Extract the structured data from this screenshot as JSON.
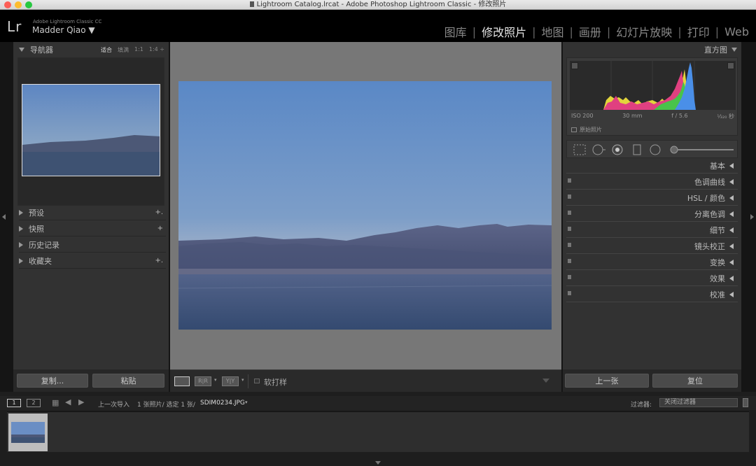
{
  "window": {
    "title": "Lightroom Catalog.lrcat - Adobe Photoshop Lightroom Classic - 修改照片",
    "traffic_colors": [
      "#fc5f57",
      "#fdbc2e",
      "#28c840"
    ]
  },
  "identity": {
    "logo": "Lr",
    "app_name": "Adobe Lightroom Classic CC",
    "user": "Madder Qiao ▼"
  },
  "modules": [
    {
      "label": "图库",
      "active": false
    },
    {
      "label": "修改照片",
      "active": true
    },
    {
      "label": "地图",
      "active": false
    },
    {
      "label": "画册",
      "active": false
    },
    {
      "label": "幻灯片放映",
      "active": false
    },
    {
      "label": "打印",
      "active": false
    },
    {
      "label": "Web",
      "active": false
    }
  ],
  "left": {
    "navigator": {
      "title": "导航器",
      "options": [
        "适合",
        "填满",
        "1:1",
        "1:4 ÷"
      ]
    },
    "panels": [
      {
        "label": "预设",
        "action": "+."
      },
      {
        "label": "快照",
        "action": "+"
      },
      {
        "label": "历史记录",
        "action": ""
      },
      {
        "label": "收藏夹",
        "action": "+."
      }
    ],
    "buttons": {
      "copy": "复制...",
      "paste": "粘贴"
    }
  },
  "toolbar": {
    "compare_label": "R|R",
    "yy_label": "Y|Y",
    "soft_proof": "软打样"
  },
  "right": {
    "histogram": {
      "title": "直方图",
      "iso": "ISO 200",
      "focal": "30 mm",
      "aperture": "f / 5.6",
      "shutter": "¹⁄₃₂₀ 秒",
      "original_photo": "原始照片"
    },
    "sections": [
      {
        "label": "基本",
        "switch": false
      },
      {
        "label": "色调曲线",
        "switch": true
      },
      {
        "label": "HSL / 颜色",
        "switch": true
      },
      {
        "label": "分离色调",
        "switch": true
      },
      {
        "label": "细节",
        "switch": true
      },
      {
        "label": "镜头校正",
        "switch": true
      },
      {
        "label": "变换",
        "switch": true
      },
      {
        "label": "效果",
        "switch": true
      },
      {
        "label": "校准",
        "switch": true
      }
    ],
    "buttons": {
      "previous": "上一张",
      "reset": "复位"
    }
  },
  "filmstrip": {
    "screen1": "1",
    "screen2": "2",
    "source": "上一次导入",
    "count": "1 张照片/ 选定 1 张/",
    "filename": "SDIM0234.JPG",
    "filter_label": "过滤器:",
    "filter_value": "关闭过滤器"
  }
}
